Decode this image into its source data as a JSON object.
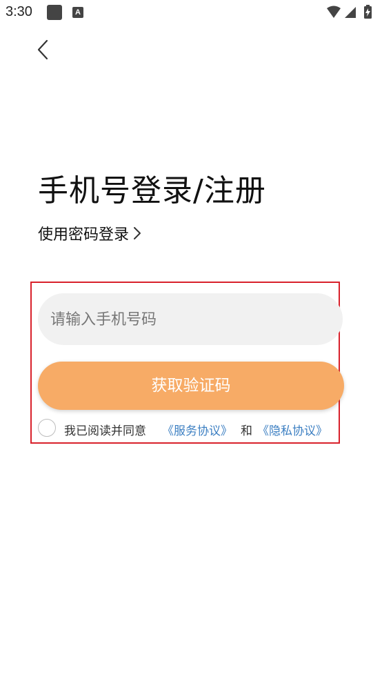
{
  "status_bar": {
    "time": "3:30",
    "icons": [
      "app-icon",
      "a-icon",
      "wifi-icon",
      "signal-icon",
      "battery-icon"
    ],
    "a_icon_label": "A"
  },
  "header": {
    "back_icon": "chevron-left-icon"
  },
  "title": "手机号登录/注册",
  "password_login": {
    "label": "使用密码登录",
    "icon": "chevron-right-icon"
  },
  "phone_input": {
    "value": "",
    "placeholder": "请输入手机号码"
  },
  "get_code_button": {
    "label": "获取验证码"
  },
  "agreement": {
    "checked": false,
    "text": "我已阅读并同意",
    "service_link": "《服务协议》",
    "and_text": "和",
    "privacy_link": "《隐私协议》"
  },
  "colors": {
    "accent": "#f7ab66",
    "link": "#3c7fc2",
    "input_bg": "#f1f1f1",
    "highlight": "#d8202a"
  }
}
